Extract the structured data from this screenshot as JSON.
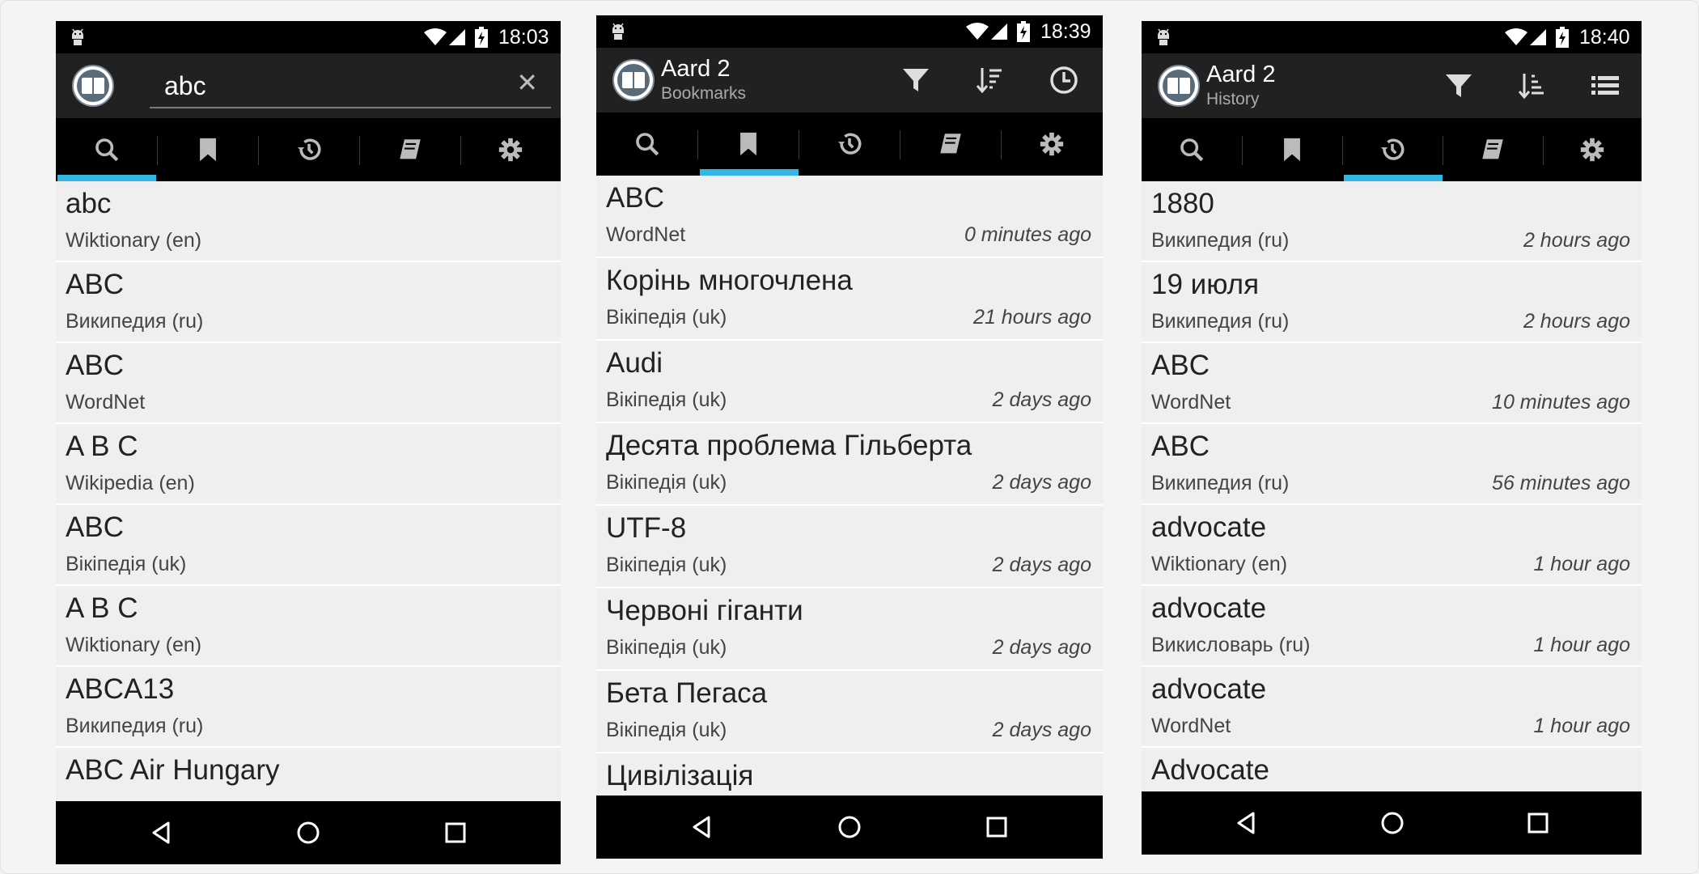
{
  "status_time": [
    "18:03",
    "18:39",
    "18:40"
  ],
  "search": {
    "query": "abc",
    "clear_label": "✕"
  },
  "app": {
    "title": "Aard 2",
    "bookmarks_subtitle": "Bookmarks",
    "history_subtitle": "History"
  },
  "tabs": [
    "search",
    "bookmarks",
    "history",
    "dictionaries",
    "settings"
  ],
  "icons": {
    "status": [
      "android-icon",
      "wifi-icon",
      "signal-icon",
      "battery-icon"
    ],
    "actions_bookmarks": [
      "filter-icon",
      "sort-icon",
      "clock-icon"
    ],
    "actions_history": [
      "filter-icon",
      "sort-icon",
      "list-icon"
    ],
    "nav": [
      "back-icon",
      "home-icon",
      "recents-icon"
    ]
  },
  "colors": {
    "accent": "#33b5e5",
    "action_bar": "#212121",
    "tab_bar": "#000000"
  },
  "lookup_results": [
    {
      "title": "abc",
      "source": "Wiktionary (en)"
    },
    {
      "title": "ABC",
      "source": "Википедия (ru)"
    },
    {
      "title": "ABC",
      "source": "WordNet"
    },
    {
      "title": "A B C",
      "source": "Wikipedia (en)"
    },
    {
      "title": "ABC",
      "source": "Вікіпедія (uk)"
    },
    {
      "title": "A B C",
      "source": "Wiktionary (en)"
    },
    {
      "title": "ABCA13",
      "source": "Википедия (ru)"
    },
    {
      "title": "ABC Air Hungary",
      "source": ""
    }
  ],
  "bookmarks": [
    {
      "title": "ABC",
      "source": "WordNet",
      "time": "0 minutes ago"
    },
    {
      "title": "Корінь многочлена",
      "source": "Вікіпедія (uk)",
      "time": "21 hours ago"
    },
    {
      "title": "Audi",
      "source": "Вікіпедія (uk)",
      "time": "2 days ago"
    },
    {
      "title": "Десята проблема Гільберта",
      "source": "Вікіпедія (uk)",
      "time": "2 days ago"
    },
    {
      "title": "UTF-8",
      "source": "Вікіпедія (uk)",
      "time": "2 days ago"
    },
    {
      "title": "Червоні гіганти",
      "source": "Вікіпедія (uk)",
      "time": "2 days ago"
    },
    {
      "title": "Бета Пегаса",
      "source": "Вікіпедія (uk)",
      "time": "2 days ago"
    },
    {
      "title": "Цивілізація",
      "source": "",
      "time": ""
    }
  ],
  "history": [
    {
      "title": "1880",
      "source": "Википедия (ru)",
      "time": "2 hours ago"
    },
    {
      "title": "19 июля",
      "source": "Википедия (ru)",
      "time": "2 hours ago"
    },
    {
      "title": "ABC",
      "source": "WordNet",
      "time": "10 minutes ago"
    },
    {
      "title": "ABC",
      "source": "Википедия (ru)",
      "time": "56 minutes ago"
    },
    {
      "title": "advocate",
      "source": "Wiktionary (en)",
      "time": "1 hour ago"
    },
    {
      "title": "advocate",
      "source": "Викисловарь (ru)",
      "time": "1 hour ago"
    },
    {
      "title": "advocate",
      "source": "WordNet",
      "time": "1 hour ago"
    },
    {
      "title": "Advocate",
      "source": "",
      "time": ""
    }
  ]
}
